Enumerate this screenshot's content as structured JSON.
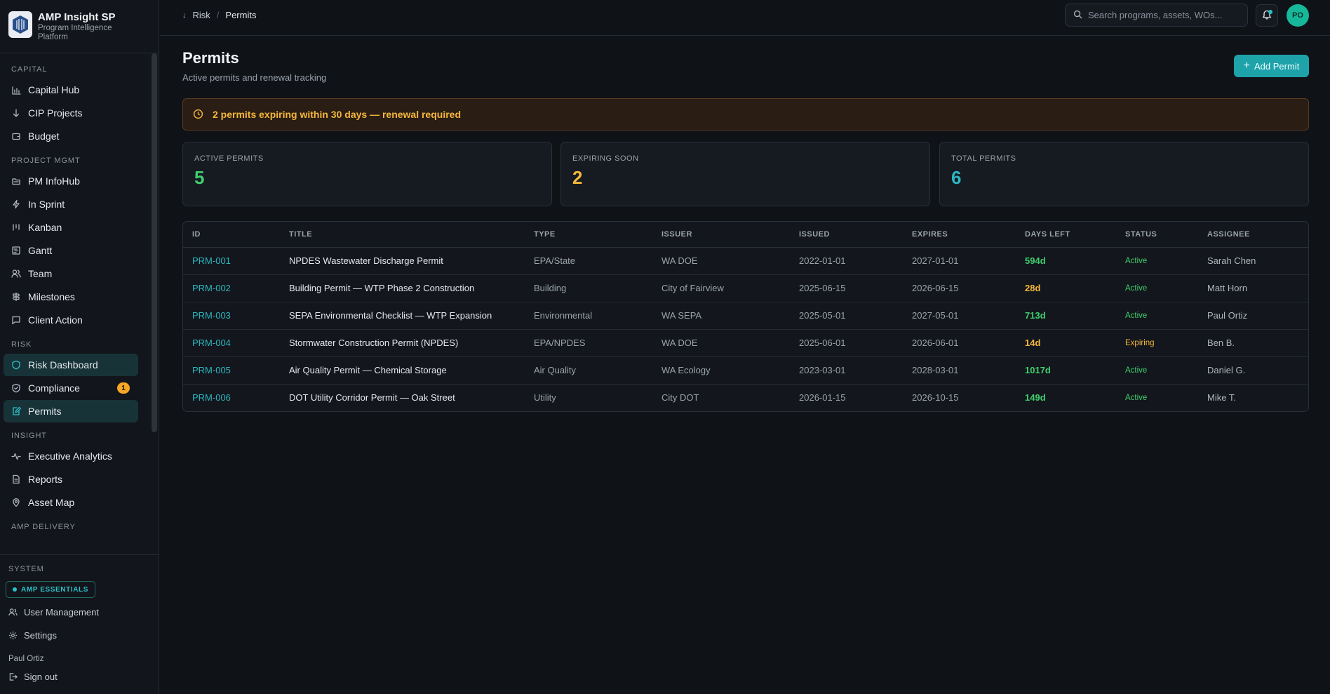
{
  "brand": {
    "title": "AMP Insight SP",
    "subtitle": "Program Intelligence Platform"
  },
  "sidebar": {
    "sections": [
      {
        "label": "CAPITAL",
        "items": [
          {
            "label": "Capital Hub",
            "icon": "bar-chart-icon"
          },
          {
            "label": "CIP Projects",
            "icon": "arrow-down-icon"
          },
          {
            "label": "Budget",
            "icon": "wallet-icon"
          }
        ]
      },
      {
        "label": "PROJECT MGMT",
        "items": [
          {
            "label": "PM InfoHub",
            "icon": "folder-icon"
          },
          {
            "label": "In Sprint",
            "icon": "lightning-icon"
          },
          {
            "label": "Kanban",
            "icon": "kanban-icon"
          },
          {
            "label": "Gantt",
            "icon": "gantt-icon"
          },
          {
            "label": "Team",
            "icon": "users-icon"
          },
          {
            "label": "Milestones",
            "icon": "signpost-icon"
          },
          {
            "label": "Client Action",
            "icon": "message-icon"
          }
        ]
      },
      {
        "label": "RISK",
        "items": [
          {
            "label": "Risk Dashboard",
            "icon": "shield-icon",
            "active": true
          },
          {
            "label": "Compliance",
            "icon": "shield-check-icon",
            "badge": "1"
          },
          {
            "label": "Permits",
            "icon": "edit-file-icon",
            "active": true
          }
        ]
      },
      {
        "label": "INSIGHT",
        "items": [
          {
            "label": "Executive Analytics",
            "icon": "activity-icon"
          },
          {
            "label": "Reports",
            "icon": "document-icon"
          },
          {
            "label": "Asset Map",
            "icon": "map-pin-icon"
          }
        ]
      },
      {
        "label": "AMP DELIVERY",
        "items": []
      }
    ],
    "system": {
      "label": "SYSTEM",
      "badge": "AMP ESSENTIALS",
      "user_management": "User Management",
      "settings": "Settings",
      "username": "Paul Ortiz",
      "sign_out": "Sign out"
    }
  },
  "topbar": {
    "breadcrumb": [
      "Risk",
      "Permits"
    ],
    "search_placeholder": "Search programs, assets, WOs...",
    "avatar_initials": "PO"
  },
  "page": {
    "title": "Permits",
    "subtitle": "Active permits and renewal tracking",
    "add_button": "Add Permit",
    "alert": "2 permits expiring within 30 days — renewal required"
  },
  "stats": [
    {
      "label": "ACTIVE PERMITS",
      "value": "5",
      "color": "#3fcf6e"
    },
    {
      "label": "EXPIRING SOON",
      "value": "2",
      "color": "#f5b73b"
    },
    {
      "label": "TOTAL PERMITS",
      "value": "6",
      "color": "#2cb7c0"
    }
  ],
  "table": {
    "headers": [
      "ID",
      "TITLE",
      "TYPE",
      "ISSUER",
      "ISSUED",
      "EXPIRES",
      "DAYS LEFT",
      "STATUS",
      "ASSIGNEE"
    ],
    "rows": [
      {
        "id": "PRM-001",
        "title": "NPDES Wastewater Discharge Permit",
        "type": "EPA/State",
        "issuer": "WA DOE",
        "issued": "2022-01-01",
        "expires": "2027-01-01",
        "days": "594d",
        "status": "Active",
        "assignee": "Sarah Chen"
      },
      {
        "id": "PRM-002",
        "title": "Building Permit — WTP Phase 2 Construction",
        "type": "Building",
        "issuer": "City of Fairview",
        "issued": "2025-06-15",
        "expires": "2026-06-15",
        "days": "28d",
        "status": "Active",
        "assignee": "Matt Horn"
      },
      {
        "id": "PRM-003",
        "title": "SEPA Environmental Checklist — WTP Expansion",
        "type": "Environmental",
        "issuer": "WA SEPA",
        "issued": "2025-05-01",
        "expires": "2027-05-01",
        "days": "713d",
        "status": "Active",
        "assignee": "Paul Ortiz"
      },
      {
        "id": "PRM-004",
        "title": "Stormwater Construction Permit (NPDES)",
        "type": "EPA/NPDES",
        "issuer": "WA DOE",
        "issued": "2025-06-01",
        "expires": "2026-06-01",
        "days": "14d",
        "status": "Expiring",
        "assignee": "Ben B."
      },
      {
        "id": "PRM-005",
        "title": "Air Quality Permit — Chemical Storage",
        "type": "Air Quality",
        "issuer": "WA Ecology",
        "issued": "2023-03-01",
        "expires": "2028-03-01",
        "days": "1017d",
        "status": "Active",
        "assignee": "Daniel G."
      },
      {
        "id": "PRM-006",
        "title": "DOT Utility Corridor Permit — Oak Street",
        "type": "Utility",
        "issuer": "City DOT",
        "issued": "2026-01-15",
        "expires": "2026-10-15",
        "days": "149d",
        "status": "Active",
        "assignee": "Mike T."
      }
    ]
  },
  "colors": {
    "accent": "#2cb7c0",
    "ok": "#3fcf6e",
    "warn": "#f5b73b"
  }
}
